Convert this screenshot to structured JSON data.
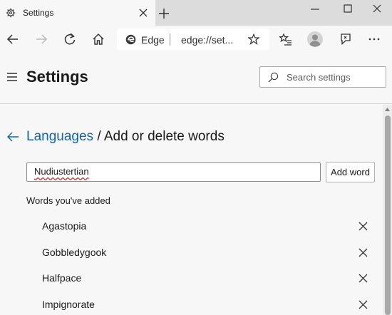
{
  "tab": {
    "title": "Settings"
  },
  "address_bar": {
    "site_name": "Edge",
    "url": "edge://set..."
  },
  "header": {
    "title": "Settings",
    "search_placeholder": "Search settings"
  },
  "breadcrumb": {
    "parent": "Languages",
    "separator": " / ",
    "current": "Add or delete words"
  },
  "word_input": {
    "value": "Nudiustertian"
  },
  "add_button": {
    "label": "Add word"
  },
  "added_section": {
    "title": "Words you've added",
    "words": [
      "Agastopia",
      "Gobbledygook",
      "Halfpace",
      "Impignorate"
    ]
  },
  "colors": {
    "link": "#0f64b4",
    "spell_error": "#d03030",
    "background": "#f7f7f7",
    "tabstrip": "#dcdcdc"
  },
  "icons": [
    "settings-gear-icon",
    "close-icon",
    "plus-icon",
    "minimize-icon",
    "maximize-icon",
    "back-icon",
    "forward-icon",
    "refresh-icon",
    "home-icon",
    "edge-logo-icon",
    "star-icon",
    "favorites-icon",
    "profile-icon",
    "feedback-icon",
    "more-icon",
    "hamburger-icon",
    "search-icon",
    "back-arrow-icon",
    "remove-icon",
    "scroll-up-icon"
  ]
}
